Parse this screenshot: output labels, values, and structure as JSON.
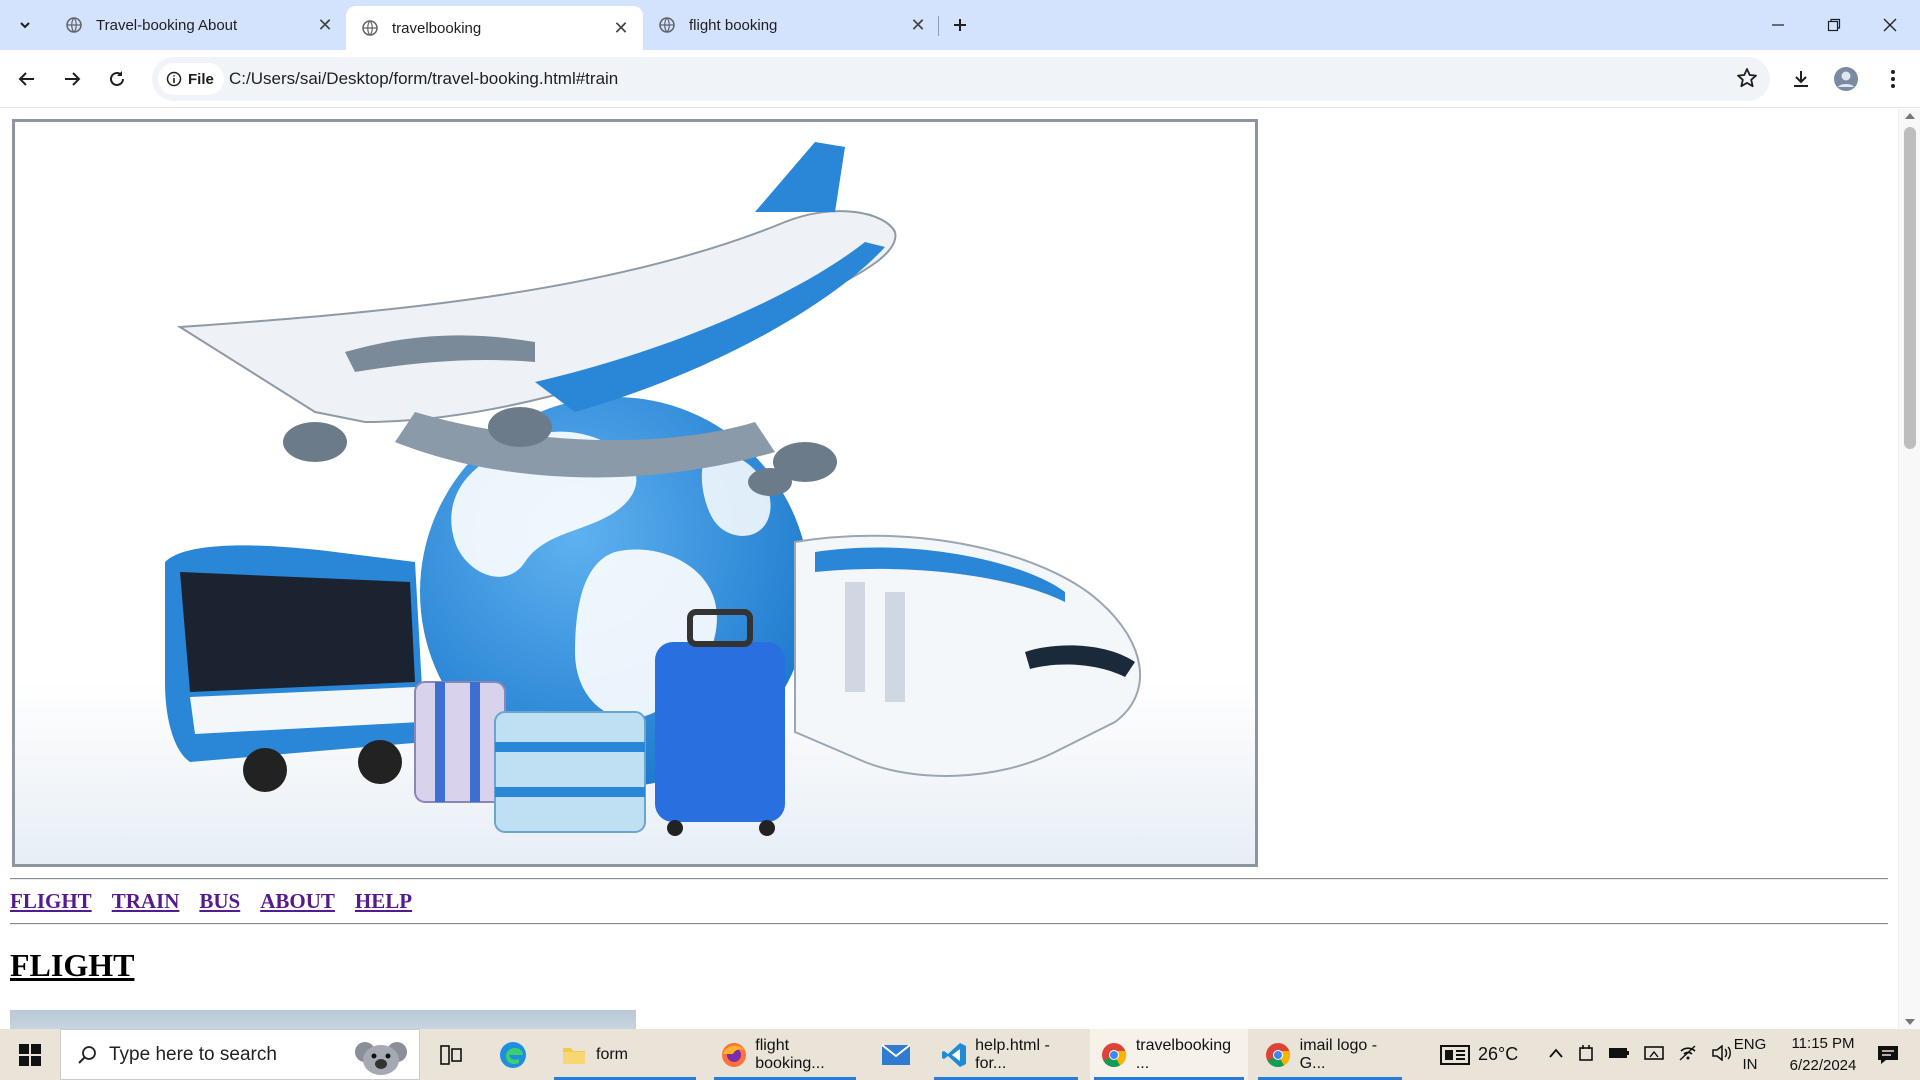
{
  "browser": {
    "tabs": [
      {
        "title": "Travel-booking About",
        "active": false
      },
      {
        "title": "travelbooking",
        "active": true
      },
      {
        "title": "flight booking",
        "active": false
      }
    ],
    "chip_label": "File",
    "url": "C:/Users/sai/Desktop/form/travel-booking.html#train"
  },
  "page": {
    "nav": [
      "FLIGHT",
      "TRAIN",
      "BUS",
      "ABOUT",
      "HELP"
    ],
    "section_title": "FLIGHT"
  },
  "taskbar": {
    "search_placeholder": "Type here to search",
    "apps": [
      {
        "label": "form"
      },
      {
        "label": "flight booking..."
      },
      {
        "label": "help.html - for..."
      },
      {
        "label": "travelbooking ..."
      },
      {
        "label": "imail logo - G..."
      }
    ],
    "weather": "26°C",
    "lang_top": "ENG",
    "lang_bottom": "IN",
    "time": "11:15 PM",
    "date": "6/22/2024"
  },
  "colors": {
    "tabstrip": "#d3e3fd",
    "link": "#551a8b",
    "taskbar": "#e9e3d8"
  }
}
